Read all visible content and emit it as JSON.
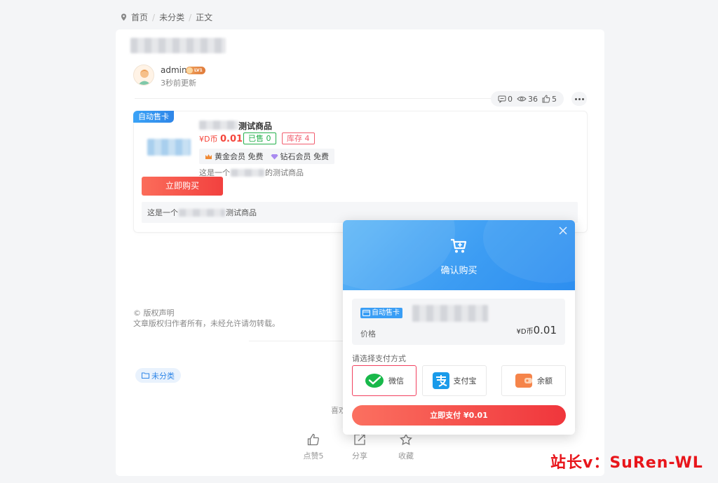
{
  "breadcrumb": {
    "home": "首页",
    "category": "未分类",
    "current": "正文"
  },
  "author": {
    "name": "admin",
    "level": "LV1",
    "updated": "3秒前更新"
  },
  "stats": {
    "comments": "0",
    "views": "36",
    "likes": "5"
  },
  "product": {
    "tag": "自动售卡",
    "name_suffix": "测试商品",
    "price_prefix": "¥D币",
    "price": "0.01",
    "sold": "已售 0",
    "stock": "库存 4",
    "vip_gold": "黄金会员 免费",
    "vip_diamond": "钻石会员 免费",
    "desc_prefix": "这是一个",
    "desc_short_suffix": "的测试商品",
    "desc_suffix": "测试商品",
    "buy_label": "立即购买"
  },
  "copyright": {
    "title": "© 版权声明",
    "text": "文章版权归作者所有，未经允许请勿转载。"
  },
  "category_tag": "未分类",
  "like_hint": "喜欢",
  "actions": {
    "like": "点赞5",
    "share": "分享",
    "favorite": "收藏"
  },
  "modal": {
    "title": "确认购买",
    "order_tag": "自动售卡",
    "price_label": "价格",
    "price_prefix": "¥D币",
    "price": "0.01",
    "pay_method_label": "请选择支付方式",
    "pay_options": {
      "wechat": "微信",
      "alipay": "支付宝",
      "balance": "余额"
    },
    "pay_button": "立即支付 ¥0.01"
  },
  "watermark": "站长v：SuRen-WL",
  "colors": {
    "accent_blue": "#2f86e8",
    "accent_red": "#f2413f",
    "success_green": "#23b04b"
  }
}
